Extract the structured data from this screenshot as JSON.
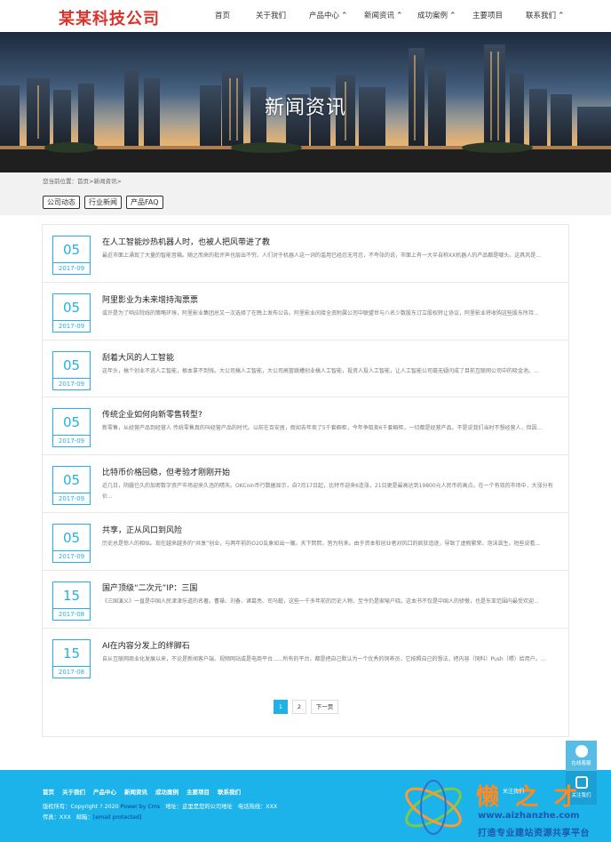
{
  "header": {
    "logo": "某某科技公司",
    "nav": [
      {
        "label": "首页",
        "has_dropdown": false
      },
      {
        "label": "关于我们",
        "has_dropdown": false
      },
      {
        "label": "产品中心",
        "has_dropdown": true
      },
      {
        "label": "新闻资讯",
        "has_dropdown": true
      },
      {
        "label": "成功案例",
        "has_dropdown": true
      },
      {
        "label": "主要项目",
        "has_dropdown": false
      },
      {
        "label": "联系我们",
        "has_dropdown": true
      }
    ]
  },
  "banner": {
    "title": "新闻资讯"
  },
  "breadcrumb": {
    "text": "您当前位置：首页>新闻资讯>"
  },
  "tabs": [
    "公司动态",
    "行业新闻",
    "产品FAQ"
  ],
  "news": [
    {
      "day": "05",
      "ym": "2017-09",
      "title": "在人工智能炒热机器人时，也被人把风带进了教",
      "desc": "最近市面上涌现了大量的智能音箱。随之而来的批评声也层出不穷。人们对于机器人这一词的滥用已经忍无可忍，不夸张的说，市面上有一大半自称XX机器人的产品都是噱头。这具风是..."
    },
    {
      "day": "05",
      "ym": "2017-09",
      "title": "阿里影业为未来增持淘票票",
      "desc": "或许是为了响应院线的策略环境，阿里影业集团总又一次选择了在晚上发布公告。阿里影业间接全资附属公司中联盟世与八名少数股东订立股权转让协议，阿里影业将收购这些股东所持..."
    },
    {
      "day": "05",
      "ym": "2017-09",
      "title": "刮着大风的人工智能",
      "desc": "这年头，搞个创业不说人工智能，根本拿不到钱。大公司搞人工智能，大公司高管跳槽创业搞人工智能，投资人投人工智能，让人工智能公司毫无疑问成了目前互联网公司中的吸金池。..."
    },
    {
      "day": "05",
      "ym": "2017-09",
      "title": "传统企业如何向新零售转型?",
      "desc": "新零售，从经营产品到经营人 传统零售真的叫经营产品的时代。以前在百安居，假如去年卖了5千套橱柜，今年争取卖6千套橱柜，一切都是经营产品。不是说我们当时不想经营人，但因..."
    },
    {
      "day": "05",
      "ym": "2017-09",
      "title": "比特币价格回稳，但考验才刚刚开始",
      "desc": "近几日，阴霾已久的加密数字资产市场迎来久违的晴天。OKCoin币行数据显示，自7月17日起，比特币迎来6连涨，21日更是最高达到19800元人民币的高点。在一个有效的市场中，大涨分有价..."
    },
    {
      "day": "05",
      "ym": "2017-09",
      "title": "共享，正从风口到风险",
      "desc": "历史总是惊人的相似。现在越来越多的“共享”创业，与两年前的O2O乱象如出一辙。天下熙熙，皆为利来。由于资本和创业者对风口的疯狂追逐，导致了虚假繁荣、泡沫滋生。短些说看..."
    },
    {
      "day": "15",
      "ym": "2017-08",
      "title": "国产顶级“二次元”IP：三国",
      "desc": "《三国演义》一直是中国人民津津乐道的名著。曹操、刘备、诸葛亮、司马懿，这些一千多年前的历史人物，至今仍是家喻户晓。这本书不仅是中国人的骄傲，也是东亚范围内最受欢迎..."
    },
    {
      "day": "15",
      "ym": "2017-08",
      "title": "AI在内容分发上的绊脚石",
      "desc": "自从互联网商业化发展以来，不论是新闻客户端、视频网站或是电商平台......所有的平台，都是把自己默认为一个优秀的饲养员，它按照自己的想法，把内容（饲料）Push（喂）给用户。..."
    }
  ],
  "pagination": {
    "pages": [
      "1",
      "2"
    ],
    "next": "下一页",
    "current": "1"
  },
  "footer": {
    "nav": [
      "首页",
      "关于我们",
      "产品中心",
      "新闻资讯",
      "成功案例",
      "主要项目",
      "联系我们"
    ],
    "copyright_prefix": "版权所有：Copyright ? 2020",
    "power": "Power by Cms",
    "address": "地址：这里是您的公司地址",
    "phone": "电话热线：XXX",
    "fax": "传真：XXX",
    "email_label": "邮箱：",
    "email": "[email protected]"
  },
  "float": {
    "service": "在线客服",
    "follow": "关注我们"
  },
  "watermark": {
    "brand": "懒之才",
    "url": "www.aizhanzhe.com",
    "slogan": "打造专业建站资源共享平台",
    "follow_tag": "关注我们"
  },
  "colors": {
    "accent": "#23b0e6",
    "logo": "#d9342b",
    "footer": "#1bb3ea"
  }
}
